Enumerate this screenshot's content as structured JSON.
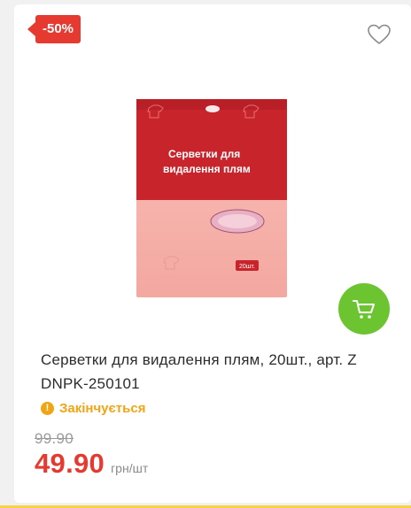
{
  "badge": {
    "discount": "-50%"
  },
  "product": {
    "image_label_line1": "Серветки для",
    "image_label_line2": "видалення плям",
    "image_count": "20шт.",
    "title": "Серветки для видалення плям, 20шт., арт. Z DNPK-250101",
    "stock_status": "Закінчується",
    "old_price": "99.90",
    "price": "49.90",
    "unit": "грн/шт"
  },
  "colors": {
    "accent_red": "#e63a31",
    "cart_green": "#6dc431",
    "stock_orange": "#f0a515"
  },
  "icons": {
    "favorite": "heart-outline-icon",
    "cart": "shopping-cart-icon",
    "stock": "exclamation-circle-icon"
  }
}
